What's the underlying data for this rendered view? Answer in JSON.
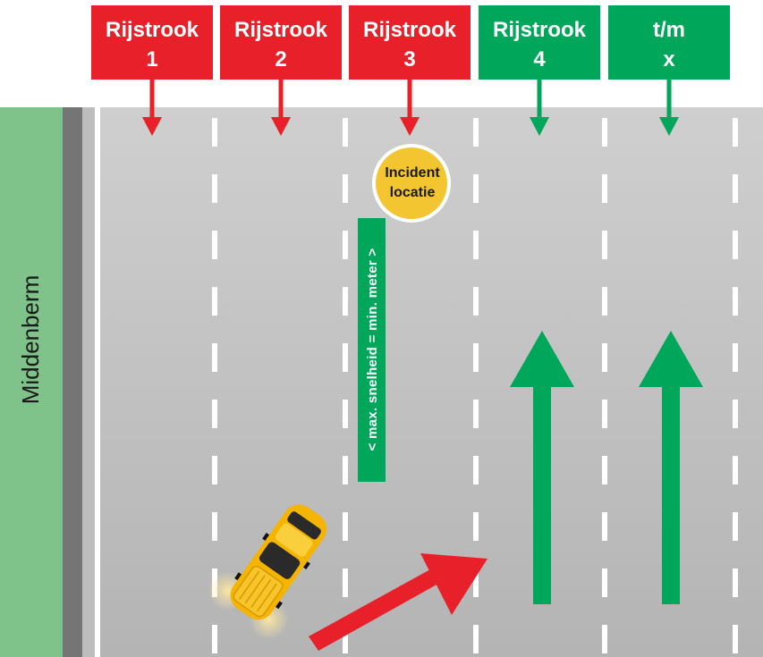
{
  "lanes": [
    {
      "line1": "Rijstrook",
      "line2": "1",
      "status": "closed"
    },
    {
      "line1": "Rijstrook",
      "line2": "2",
      "status": "closed"
    },
    {
      "line1": "Rijstrook",
      "line2": "3",
      "status": "closed"
    },
    {
      "line1": "Rijstrook",
      "line2": "4",
      "status": "open"
    },
    {
      "line1": "t/m",
      "line2": "x",
      "status": "open"
    }
  ],
  "incident": {
    "line1": "Incident",
    "line2": "locatie"
  },
  "median_label": "Middenberm",
  "speed_sign": "< max. snelheid = min. meter >",
  "colors": {
    "closed": "#e8202a",
    "open": "#00a65a",
    "road": "#c3c3c3",
    "median": "#7fc28a",
    "incident": "#f2c531",
    "vehicle": "#f4b400"
  },
  "icons": {
    "closed_marker": "arrow-down-icon",
    "open_marker": "arrow-down-icon",
    "traffic_direction": "arrow-up-icon",
    "merge": "diagonal-arrow-icon",
    "vehicle": "car-icon"
  }
}
